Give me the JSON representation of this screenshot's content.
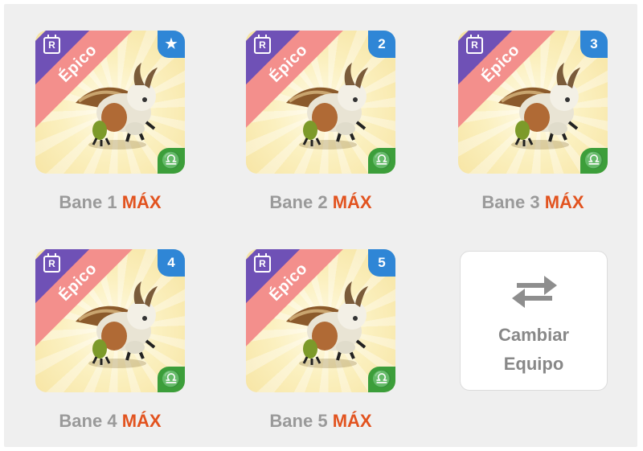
{
  "team": {
    "cards": [
      {
        "rarity_badge": "R",
        "ribbon": "Épico",
        "corner": "★",
        "corner_icon": "star-icon",
        "element_icon": "libra-element-icon",
        "element_glyph": "♎",
        "name": "Bane 1",
        "level": "MÁX"
      },
      {
        "rarity_badge": "R",
        "ribbon": "Épico",
        "corner": "2",
        "corner_icon": "",
        "element_icon": "libra-element-icon",
        "element_glyph": "♎",
        "name": "Bane 2",
        "level": "MÁX"
      },
      {
        "rarity_badge": "R",
        "ribbon": "Épico",
        "corner": "3",
        "corner_icon": "",
        "element_icon": "libra-element-icon",
        "element_glyph": "♎",
        "name": "Bane 3",
        "level": "MÁX"
      },
      {
        "rarity_badge": "R",
        "ribbon": "Épico",
        "corner": "4",
        "corner_icon": "",
        "element_icon": "libra-element-icon",
        "element_glyph": "♎",
        "name": "Bane 4",
        "level": "MÁX"
      },
      {
        "rarity_badge": "R",
        "ribbon": "Épico",
        "corner": "5",
        "corner_icon": "",
        "element_icon": "libra-element-icon",
        "element_glyph": "♎",
        "name": "Bane 5",
        "level": "MÁX"
      }
    ],
    "swap_button": {
      "line1": "Cambiar",
      "line2": "Equipo",
      "icon": "swap-arrows-icon"
    }
  },
  "colors": {
    "ribbon": "#f38f8c",
    "corner_purple": "#6f51b6",
    "corner_blue": "#2f86d6",
    "element_green": "#3c9e3a",
    "max_text": "#e2531f",
    "name_text": "#9a9a9a"
  }
}
